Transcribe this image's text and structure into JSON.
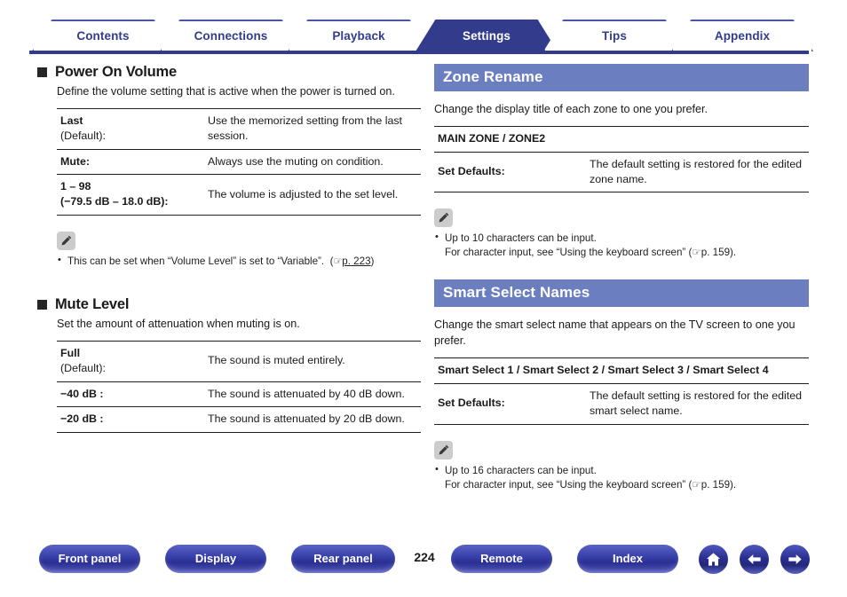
{
  "tabs": [
    {
      "label": "Contents",
      "active": false
    },
    {
      "label": "Connections",
      "active": false
    },
    {
      "label": "Playback",
      "active": false
    },
    {
      "label": "Settings",
      "active": true
    },
    {
      "label": "Tips",
      "active": false
    },
    {
      "label": "Appendix",
      "active": false
    }
  ],
  "left_column": {
    "section_power_on_volume": {
      "heading": "Power On Volume",
      "intro": "Define the volume setting that is active when the power is turned on.",
      "rows": [
        {
          "key_bold": "Last",
          "key_rest": "(Default):",
          "value": "Use the memorized setting from the last session."
        },
        {
          "key_bold": "Mute:",
          "key_rest": "",
          "value": "Always use the muting on condition."
        },
        {
          "key_bold": "1 – 98",
          "key_rest": "(−79.5 dB – 18.0 dB):",
          "value": "The volume is adjusted to the set level."
        }
      ],
      "note": {
        "icon": "pencil-note-icon",
        "line1": "This can be set when “Volume Level” is set to “Variable”.",
        "xref_icon": "☞",
        "xref_page": "p. 223",
        "xref_open": "(",
        "xref_close": ")"
      }
    },
    "section_mute_level": {
      "heading": "Mute Level",
      "intro": "Set the amount of attenuation when muting is on.",
      "rows": [
        {
          "key_bold": "Full",
          "key_rest": "(Default):",
          "value": "The sound is muted entirely."
        },
        {
          "key_bold": "−40 dB :",
          "key_rest": "",
          "value": "The sound is attenuated by 40 dB down."
        },
        {
          "key_bold": "−20 dB :",
          "key_rest": "",
          "value": "The sound is attenuated by 20 dB down."
        }
      ]
    }
  },
  "right_column": {
    "section_zone_rename": {
      "heading": "Zone Rename",
      "intro": "Change the display title of each zone to one you prefer.",
      "group_header": "MAIN ZONE / ZONE2",
      "rows": [
        {
          "key_bold": "Set Defaults:",
          "key_rest": "",
          "value": "The default setting is restored for the edited zone name."
        }
      ],
      "note": {
        "icon": "pencil-note-icon",
        "line1": "Up to 10 characters can be input.",
        "line2_prefix": "For character input, see “Using the keyboard screen” (",
        "xref_icon": "☞",
        "xref_page": "p. 159",
        "line2_suffix": ")."
      }
    },
    "section_smart_select_names": {
      "heading": "Smart Select Names",
      "intro": "Change the smart select name that appears on the TV screen to one you prefer.",
      "group_header": "Smart Select 1 / Smart Select 2 / Smart Select 3 / Smart Select 4",
      "rows": [
        {
          "key_bold": "Set Defaults:",
          "key_rest": "",
          "value": "The default setting is restored for the edited smart select name."
        }
      ],
      "note": {
        "icon": "pencil-note-icon",
        "line1": "Up to 16 characters can be input.",
        "line2_prefix": "For character input, see “Using the keyboard screen” (",
        "xref_icon": "☞",
        "xref_page": "p. 159",
        "line2_suffix": ")."
      }
    }
  },
  "footer": {
    "buttons": [
      {
        "label": "Front panel"
      },
      {
        "label": "Display"
      },
      {
        "label": "Rear panel"
      },
      {
        "label": "Remote"
      },
      {
        "label": "Index"
      }
    ],
    "page_number": "224",
    "icon_buttons": [
      {
        "name": "home-icon"
      },
      {
        "name": "arrow-left-icon"
      },
      {
        "name": "arrow-right-icon"
      }
    ]
  },
  "colors": {
    "tab_navy": "#333c8c",
    "section_bar_blue": "#6b7fc0",
    "rule_navy": "#333c8c",
    "text": "#1a1a1a"
  }
}
